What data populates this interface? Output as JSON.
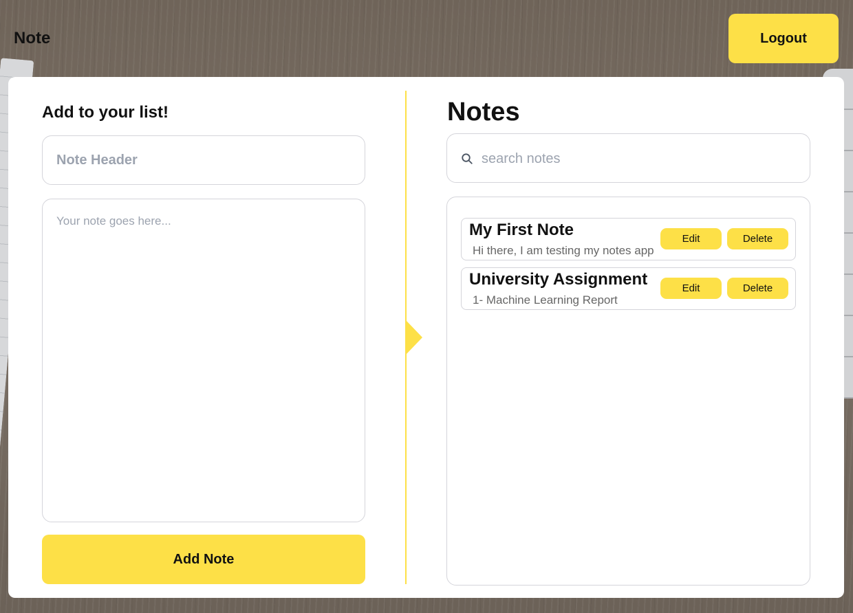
{
  "header": {
    "app_title": "Note",
    "logout_label": "Logout"
  },
  "composer": {
    "title": "Add to your list!",
    "header_placeholder": "Note Header",
    "body_placeholder": "Your note goes here...",
    "add_label": "Add Note"
  },
  "notes_panel": {
    "title": "Notes",
    "search_placeholder": "search notes",
    "search_icon": "search-icon",
    "items": [
      {
        "title": "My First Note",
        "body": "Hi there, I am testing my notes app",
        "edit_label": "Edit",
        "delete_label": "Delete"
      },
      {
        "title": "University Assignment",
        "body": "1- Machine Learning Report",
        "edit_label": "Edit",
        "delete_label": "Delete"
      }
    ]
  },
  "colors": {
    "accent": "#fde047",
    "border": "#d4d4da",
    "placeholder": "#9ca3af"
  }
}
